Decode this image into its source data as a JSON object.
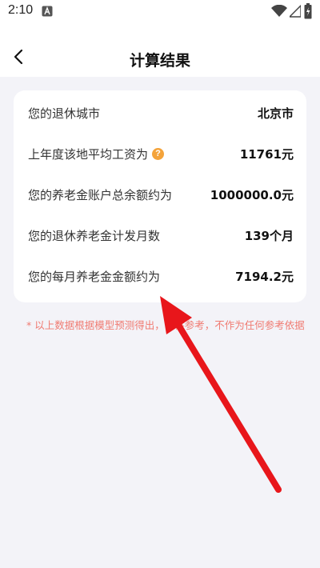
{
  "status_bar": {
    "time": "2:10",
    "icons": [
      "app-notification-icon",
      "wifi-icon",
      "signal-icon",
      "battery-icon"
    ]
  },
  "header": {
    "title": "计算结果",
    "back_icon": "chevron-left-icon"
  },
  "results": [
    {
      "label": "您的退休城市",
      "value": "北京市"
    },
    {
      "label": "上年度该地平均工资为",
      "value": "11761元",
      "help_icon": "question-icon"
    },
    {
      "label": "您的养老金账户总余额约为",
      "value": "1000000.0元"
    },
    {
      "label": "您的退休养老金计发月数",
      "value": "139个月"
    },
    {
      "label": "您的每月养老金金额约为",
      "value": "7194.2元"
    }
  ],
  "help_icon_text": "?",
  "disclaimer": "* 以上数据根据模型预测得出，仅供参考，不作为任何参考依据",
  "colors": {
    "background": "#f3f3f8",
    "card": "#ffffff",
    "help_icon": "#f4a33a",
    "disclaimer": "#f07b72",
    "annotation_arrow": "#e8161b"
  }
}
